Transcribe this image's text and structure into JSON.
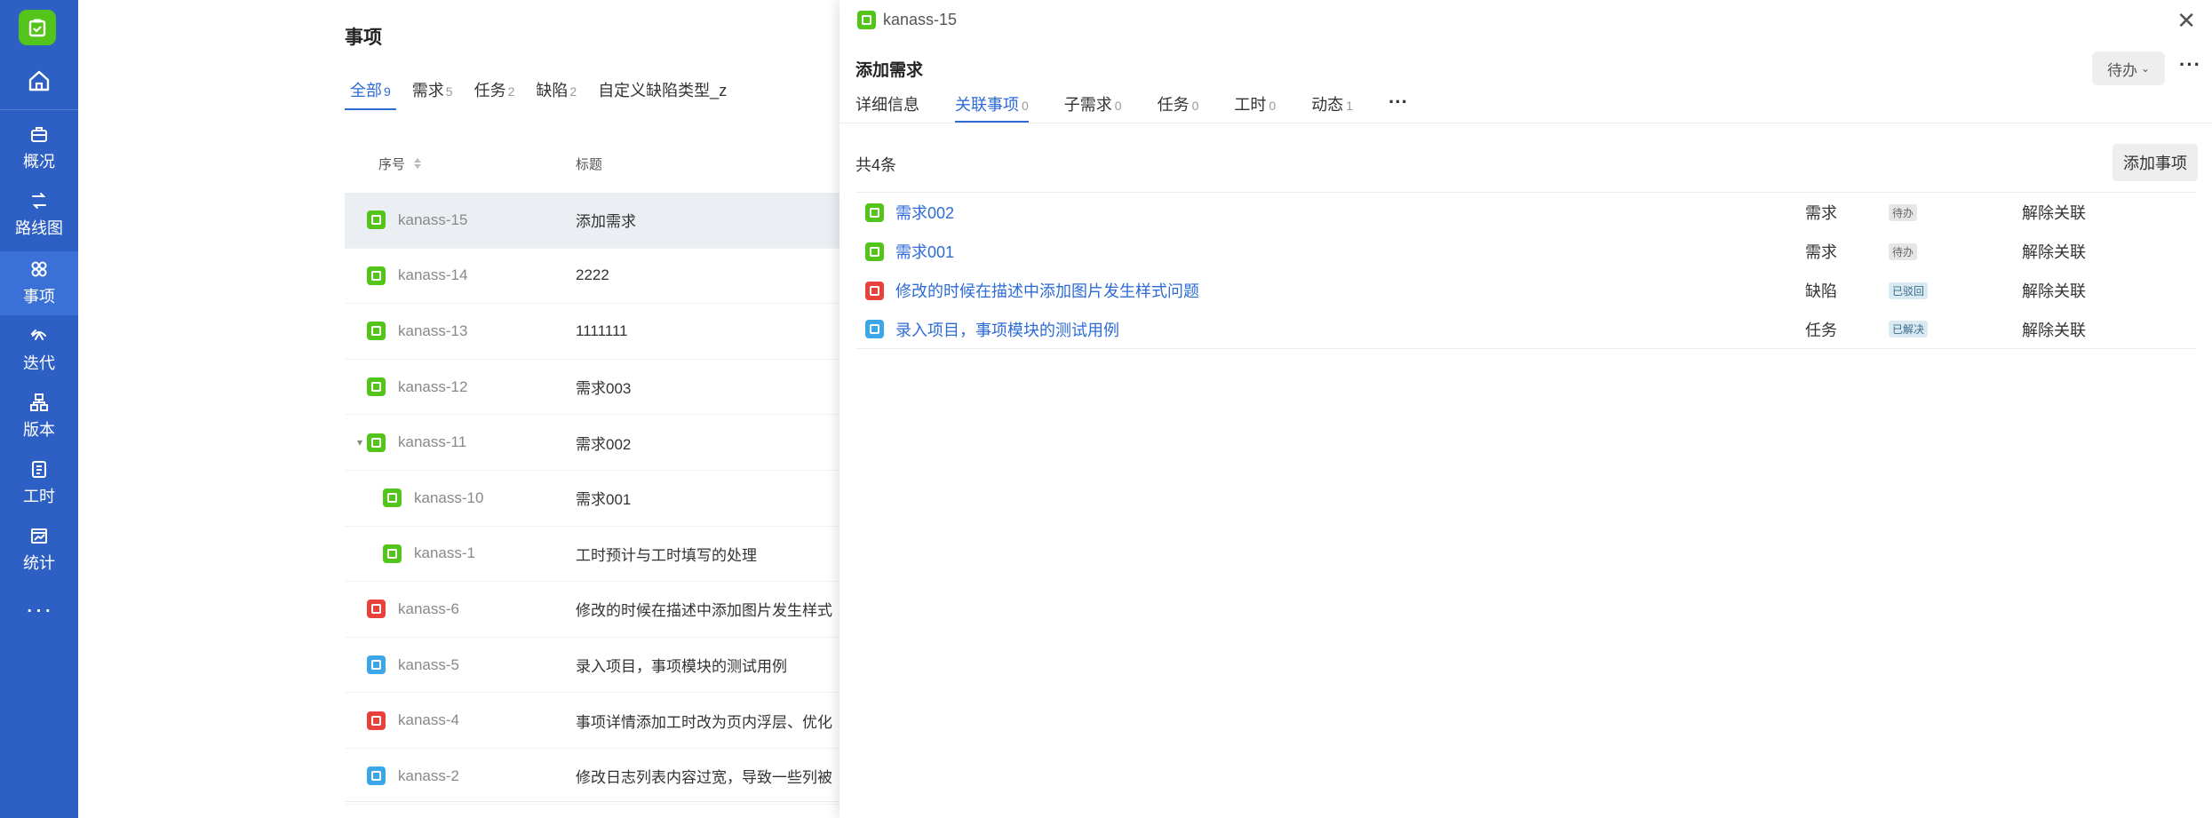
{
  "sidebar": {
    "nav": [
      {
        "label": "概况",
        "icon": "briefcase-icon"
      },
      {
        "label": "路线图",
        "icon": "route-icon"
      },
      {
        "label": "事项",
        "icon": "issues-icon"
      },
      {
        "label": "迭代",
        "icon": "sprint-icon"
      },
      {
        "label": "版本",
        "icon": "version-icon"
      },
      {
        "label": "工时",
        "icon": "worklog-icon"
      },
      {
        "label": "统计",
        "icon": "chart-icon"
      }
    ],
    "more": "···"
  },
  "main": {
    "title": "事项",
    "tabs": [
      {
        "label": "全部",
        "count": "9"
      },
      {
        "label": "需求",
        "count": "5"
      },
      {
        "label": "任务",
        "count": "2"
      },
      {
        "label": "缺陷",
        "count": "2"
      },
      {
        "label": "自定义缺陷类型_z",
        "count": ""
      }
    ],
    "columns": {
      "id": "序号",
      "title": "标题"
    },
    "rows": [
      {
        "id": "kanass-15",
        "title": "添加需求",
        "type": "req"
      },
      {
        "id": "kanass-14",
        "title": "2222",
        "type": "req"
      },
      {
        "id": "kanass-13",
        "title": "1111111",
        "type": "req"
      },
      {
        "id": "kanass-12",
        "title": "需求003",
        "type": "req"
      },
      {
        "id": "kanass-11",
        "title": "需求002",
        "type": "req"
      },
      {
        "id": "kanass-10",
        "title": "需求001",
        "type": "req"
      },
      {
        "id": "kanass-1",
        "title": "工时预计与工时填写的处理",
        "type": "req"
      },
      {
        "id": "kanass-6",
        "title": "修改的时候在描述中添加图片发生样式",
        "type": "bug"
      },
      {
        "id": "kanass-5",
        "title": "录入项目，事项模块的测试用例",
        "type": "task"
      },
      {
        "id": "kanass-4",
        "title": "事项详情添加工时改为页内浮层、优化",
        "type": "bug"
      },
      {
        "id": "kanass-2",
        "title": "修改日志列表内容过宽，导致一些列被",
        "type": "task"
      }
    ]
  },
  "drawer": {
    "issue_key": "kanass-15",
    "title": "添加需求",
    "status": "待办",
    "tabs": [
      {
        "label": "详细信息",
        "count": ""
      },
      {
        "label": "关联事项",
        "count": "0"
      },
      {
        "label": "子需求",
        "count": "0"
      },
      {
        "label": "任务",
        "count": "0"
      },
      {
        "label": "工时",
        "count": "0"
      },
      {
        "label": "动态",
        "count": "1"
      }
    ],
    "tabs_more": "···",
    "total": "共4条",
    "add_button": "添加事项",
    "relations": [
      {
        "title": "需求002",
        "type": "需求",
        "status": "待办",
        "action": "解除关联",
        "kind": "req"
      },
      {
        "title": "需求001",
        "type": "需求",
        "status": "待办",
        "action": "解除关联",
        "kind": "req"
      },
      {
        "title": "修改的时候在描述中添加图片发生样式问题",
        "type": "缺陷",
        "status": "已驳回",
        "action": "解除关联",
        "kind": "bug"
      },
      {
        "title": "录入项目，事项模块的测试用例",
        "type": "任务",
        "status": "已解决",
        "action": "解除关联",
        "kind": "task"
      }
    ]
  },
  "colors": {
    "sidebar": "#2d5fc4",
    "accent": "#2d6bd6",
    "requirement": "#52c41a",
    "bug": "#e8413b",
    "task": "#3ba6e8"
  }
}
